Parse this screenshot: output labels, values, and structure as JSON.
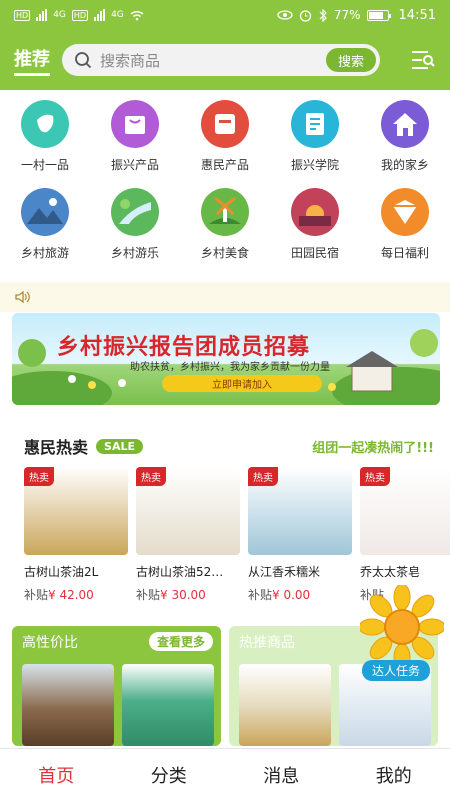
{
  "status_bar": {
    "network_left": "4G",
    "network_right": "4G",
    "battery": "77%",
    "battery_level": 0.77,
    "time": "14:51"
  },
  "header": {
    "title": "推荐",
    "search_placeholder": "搜索商品",
    "search_button": "搜索"
  },
  "categories": [
    {
      "label": "一村一品",
      "color": "#3cc7b5",
      "icon": "vegetable-icon"
    },
    {
      "label": "振兴产品",
      "color": "#b25bd6",
      "icon": "bag-icon"
    },
    {
      "label": "惠民产品",
      "color": "#e34d3d",
      "icon": "calendar-icon"
    },
    {
      "label": "振兴学院",
      "color": "#28b5d8",
      "icon": "book-icon"
    },
    {
      "label": "我的家乡",
      "color": "#7c5bd6",
      "icon": "home-icon"
    },
    {
      "label": "乡村旅游",
      "color": "#4a86c8",
      "icon": "mountain-icon"
    },
    {
      "label": "乡村游乐",
      "color": "#5cb85c",
      "icon": "road-icon"
    },
    {
      "label": "乡村美食",
      "color": "#68b848",
      "icon": "windmill-icon"
    },
    {
      "label": "田园民宿",
      "color": "#c2425a",
      "icon": "sunset-icon"
    },
    {
      "label": "每日福利",
      "color": "#f28b2a",
      "icon": "gift-icon"
    }
  ],
  "banner": {
    "title": "乡村振兴报告团成员招募",
    "subtitle": "助农扶贫，乡村振兴，我为家乡贡献一份力量",
    "button": "立即申请加入"
  },
  "hot_sale": {
    "title": "惠民热卖",
    "badge": "SALE",
    "slogan": "组团一起凑热闹了!!!",
    "price_label": "补贴",
    "products": [
      {
        "tag": "热卖",
        "name": "古树山茶油2L",
        "price": "¥ 42.00",
        "img_color": "#c9a55b"
      },
      {
        "tag": "热卖",
        "name": "古树山茶油52…",
        "price": "¥ 30.00",
        "img_color": "#e3dccb"
      },
      {
        "tag": "热卖",
        "name": "从江香禾糯米",
        "price": "¥ 0.00",
        "img_color": "#9fc6d8"
      },
      {
        "tag": "热卖",
        "name": "乔太太茶皂",
        "price": "",
        "img_color": "#efe9e6"
      }
    ]
  },
  "panels": {
    "left_title": "高性价比",
    "more": "查看更多",
    "right_title": "热推商品"
  },
  "floating": {
    "task": "达人任务"
  },
  "tabbar": {
    "items": [
      "首页",
      "分类",
      "消息",
      "我的"
    ],
    "active_color": "#e0323a"
  }
}
